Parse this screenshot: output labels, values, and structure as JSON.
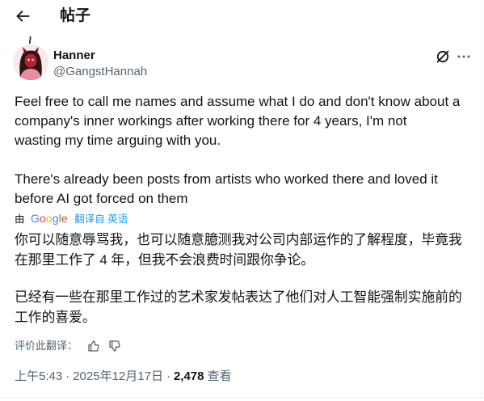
{
  "colors": {
    "text": "#0f1419",
    "muted": "#536471",
    "link": "#1d9bf0",
    "border": "#eff3f4",
    "google": [
      "#4285F4",
      "#EA4335",
      "#FBBC05",
      "#4285F4",
      "#34A853",
      "#EA4335"
    ]
  },
  "header": {
    "back_icon": "arrow-left-icon",
    "title": "帖子"
  },
  "post": {
    "author": {
      "avatar_icon": "avatar",
      "name": "Hanner",
      "handle": "@GangstHannah"
    },
    "action_icons": [
      "grok-icon",
      "more-icon"
    ],
    "body": {
      "paragraphs": [
        [
          "Feel free to call me names and assume what I do and don't know about a",
          "company's inner workings after working there for 4 years, I'm not",
          "wasting my time arguing with you."
        ],
        [
          "There's already been posts from artists who worked there and loved it",
          "before AI got forced on them"
        ]
      ]
    },
    "translation_source": {
      "prefix": "由",
      "brand": "Google",
      "link_label": "翻译自 英语"
    },
    "translation": {
      "paragraphs": [
        [
          "你可以随意辱骂我，也可以随意臆测我对公司内部运作的了解程度，毕竟我",
          "在那里工作了 4 年，但我不会浪费时间跟你争论。"
        ],
        [
          "已经有一些在那里工作过的艺术家发帖表达了他们对人工智能强制实施前的",
          "工作的喜爱。"
        ]
      ]
    },
    "rate": {
      "label": "评价此翻译：",
      "icons": [
        "thumbs-up-icon",
        "thumbs-down-icon"
      ]
    },
    "meta": {
      "time": "上午5:43",
      "separator": "·",
      "date": "2025年12月17日",
      "views": "2,478",
      "views_label": "查看"
    }
  }
}
